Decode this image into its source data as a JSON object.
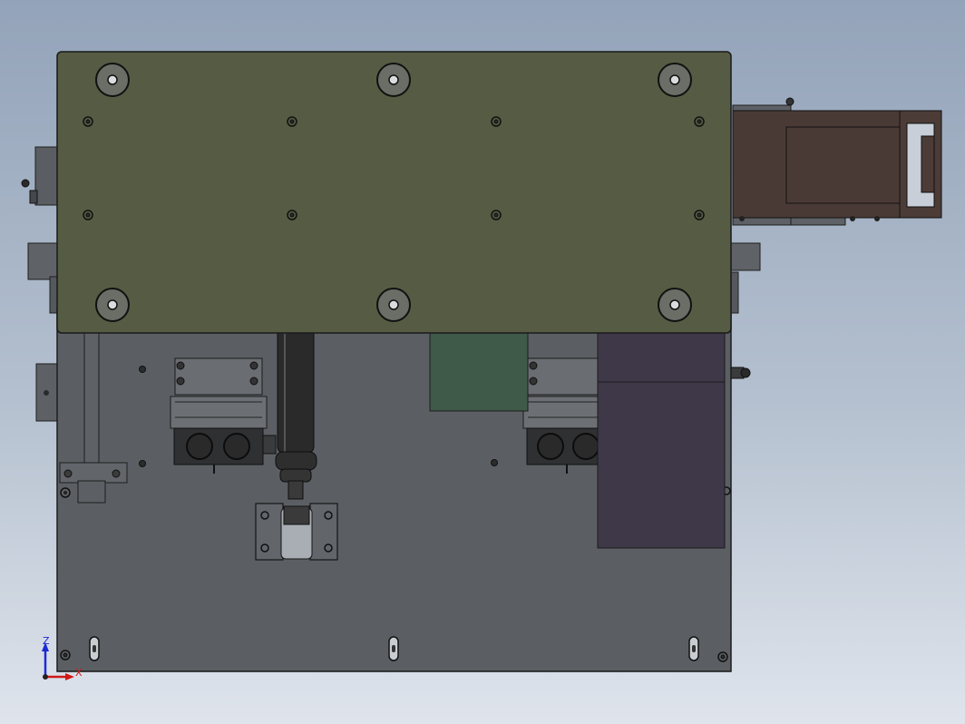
{
  "triad": {
    "z_label": "Z",
    "x_label": "X"
  },
  "colors": {
    "background_top": "#93a3b9",
    "background_bottom": "#dfe4ec",
    "top_plate": "#555c43",
    "base_plate": "#5b5f63",
    "motor_housing": "#4a3a35",
    "green_block": "#3f5a48",
    "purple_box": "#3e3848",
    "cylinder": "#2a2a2a",
    "triad_z": "#1a2bd6",
    "triad_x": "#d01818"
  }
}
